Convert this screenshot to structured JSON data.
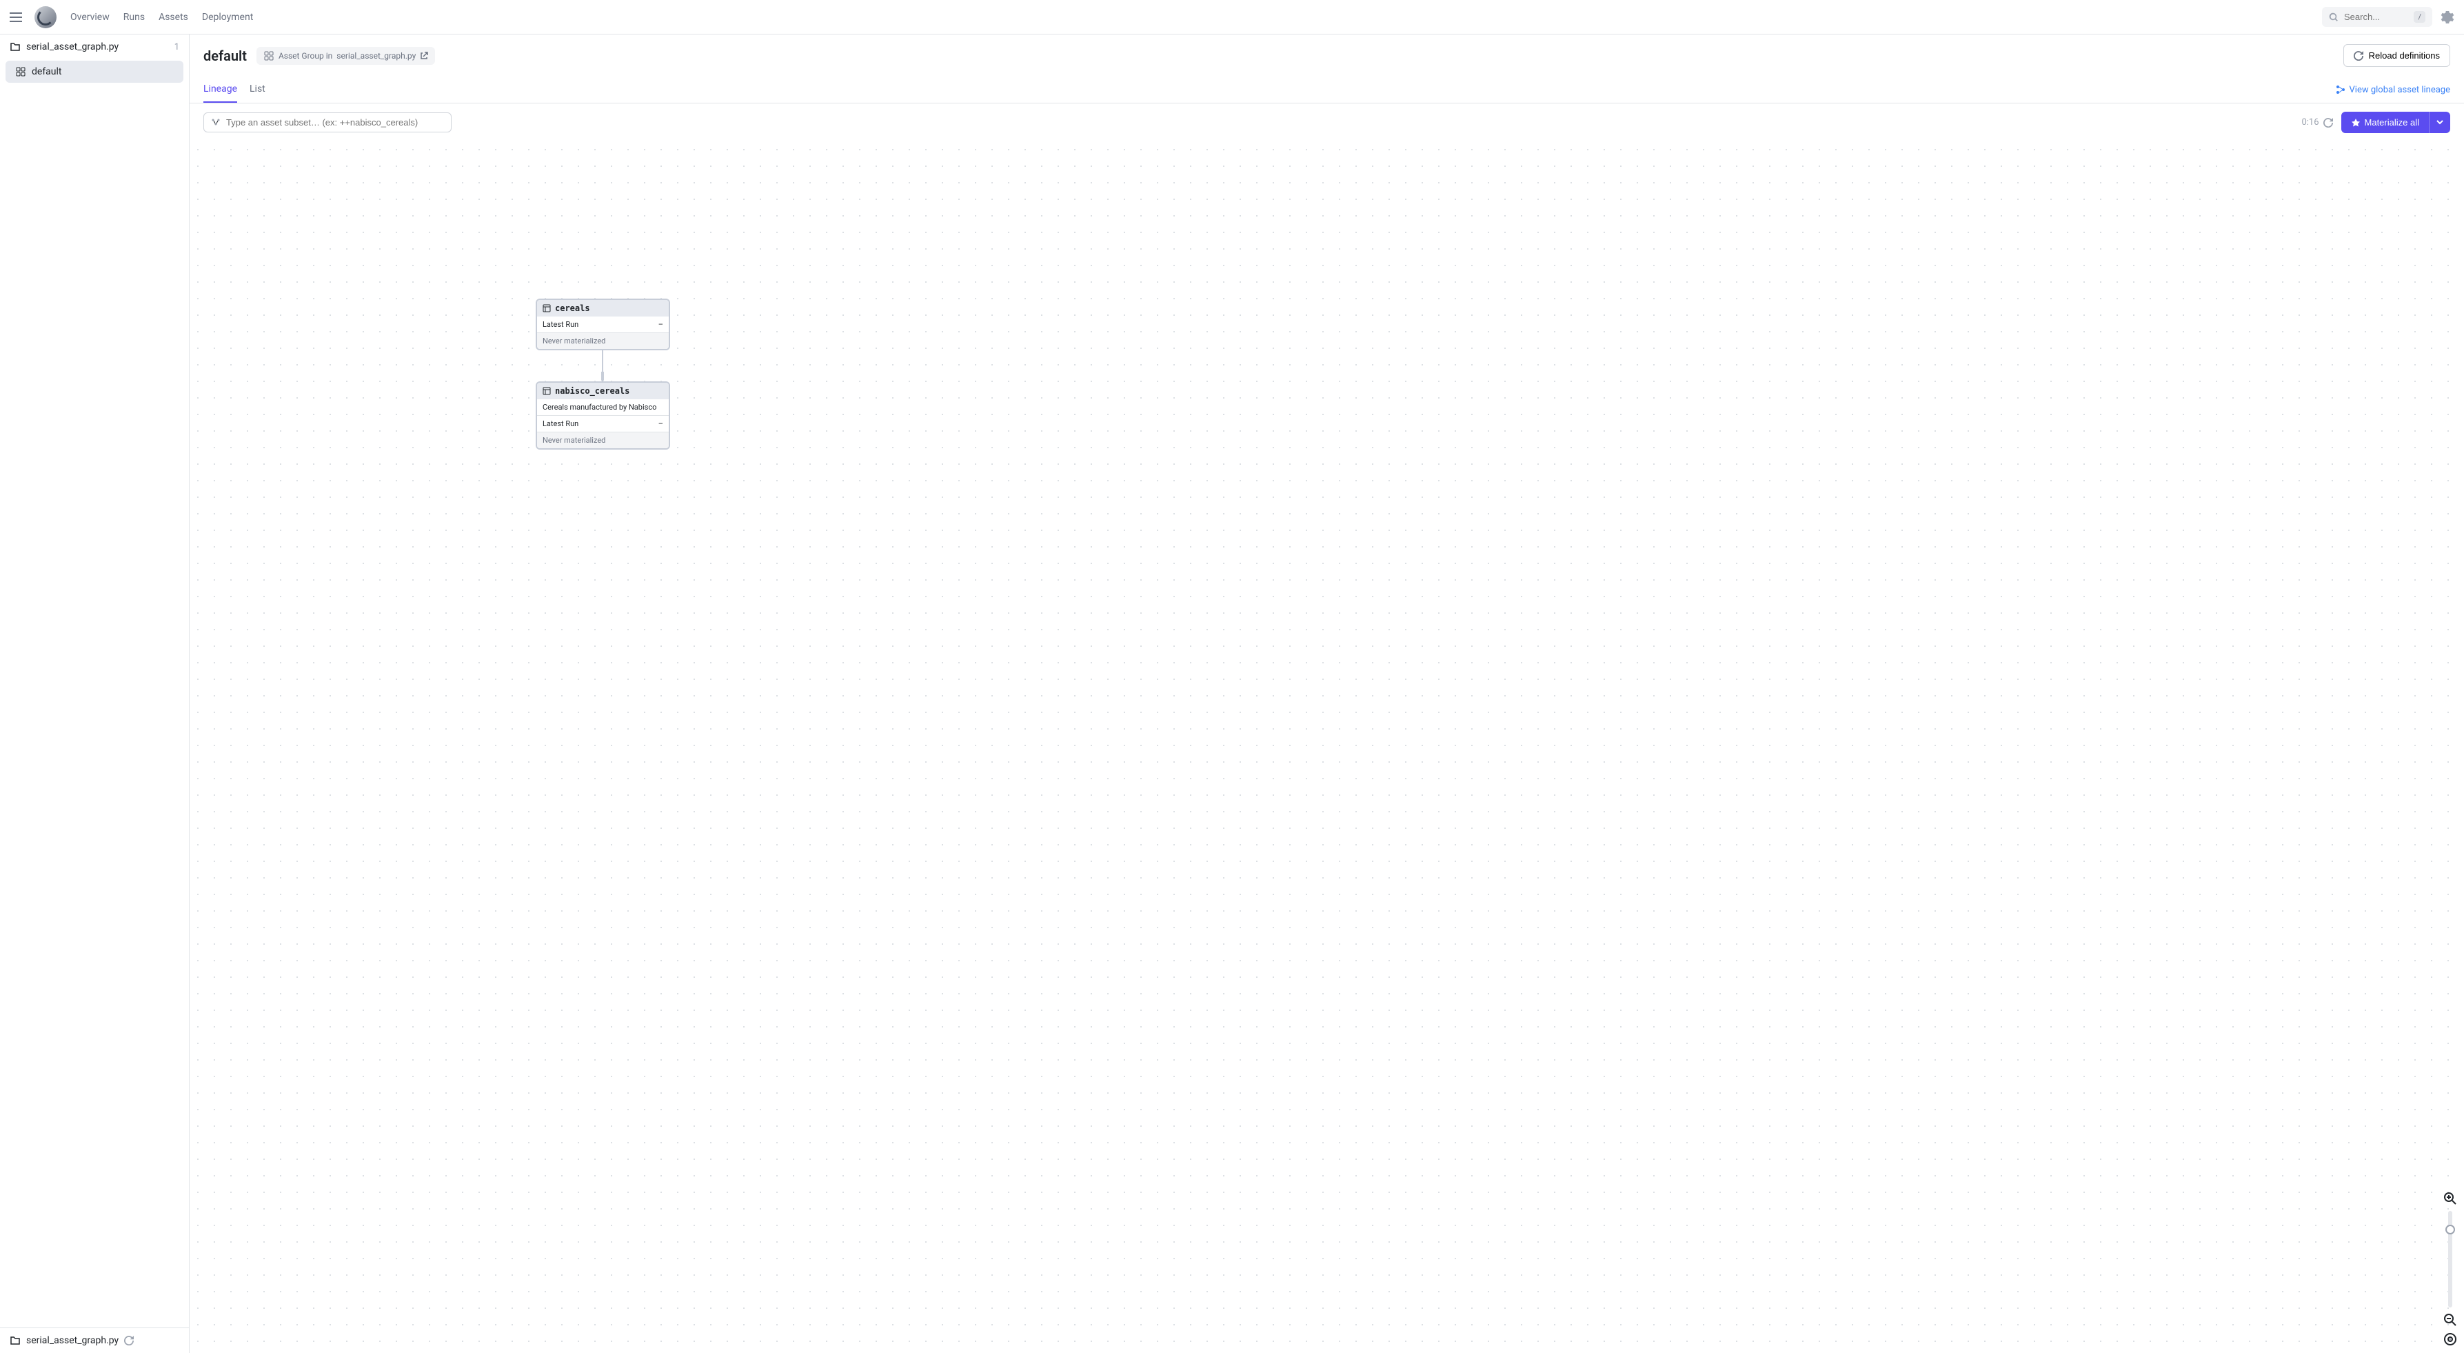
{
  "nav": {
    "overview": "Overview",
    "runs": "Runs",
    "assets": "Assets",
    "deployment": "Deployment"
  },
  "search": {
    "placeholder": "Search...",
    "shortcut": "/"
  },
  "sidebar": {
    "group": {
      "name": "serial_asset_graph.py",
      "count": "1"
    },
    "items": [
      {
        "label": "default"
      }
    ],
    "footer": "serial_asset_graph.py"
  },
  "page": {
    "title": "default",
    "meta_prefix": "Asset Group in",
    "meta_link": "serial_asset_graph.py",
    "reload_label": "Reload definitions"
  },
  "tabs": {
    "lineage": "Lineage",
    "list": "List",
    "global_lineage": "View global asset lineage"
  },
  "toolbar": {
    "filter_placeholder": "Type an asset subset… (ex: ++nabisco_cereals)",
    "timestamp": "0:16",
    "materialize_label": "Materialize all"
  },
  "nodes": {
    "cereals": {
      "name": "cereals",
      "latest_run_label": "Latest Run",
      "latest_run_value": "–",
      "status": "Never materialized"
    },
    "nabisco": {
      "name": "nabisco_cereals",
      "description": "Cereals manufactured by Nabisco",
      "latest_run_label": "Latest Run",
      "latest_run_value": "–",
      "status": "Never materialized"
    }
  }
}
